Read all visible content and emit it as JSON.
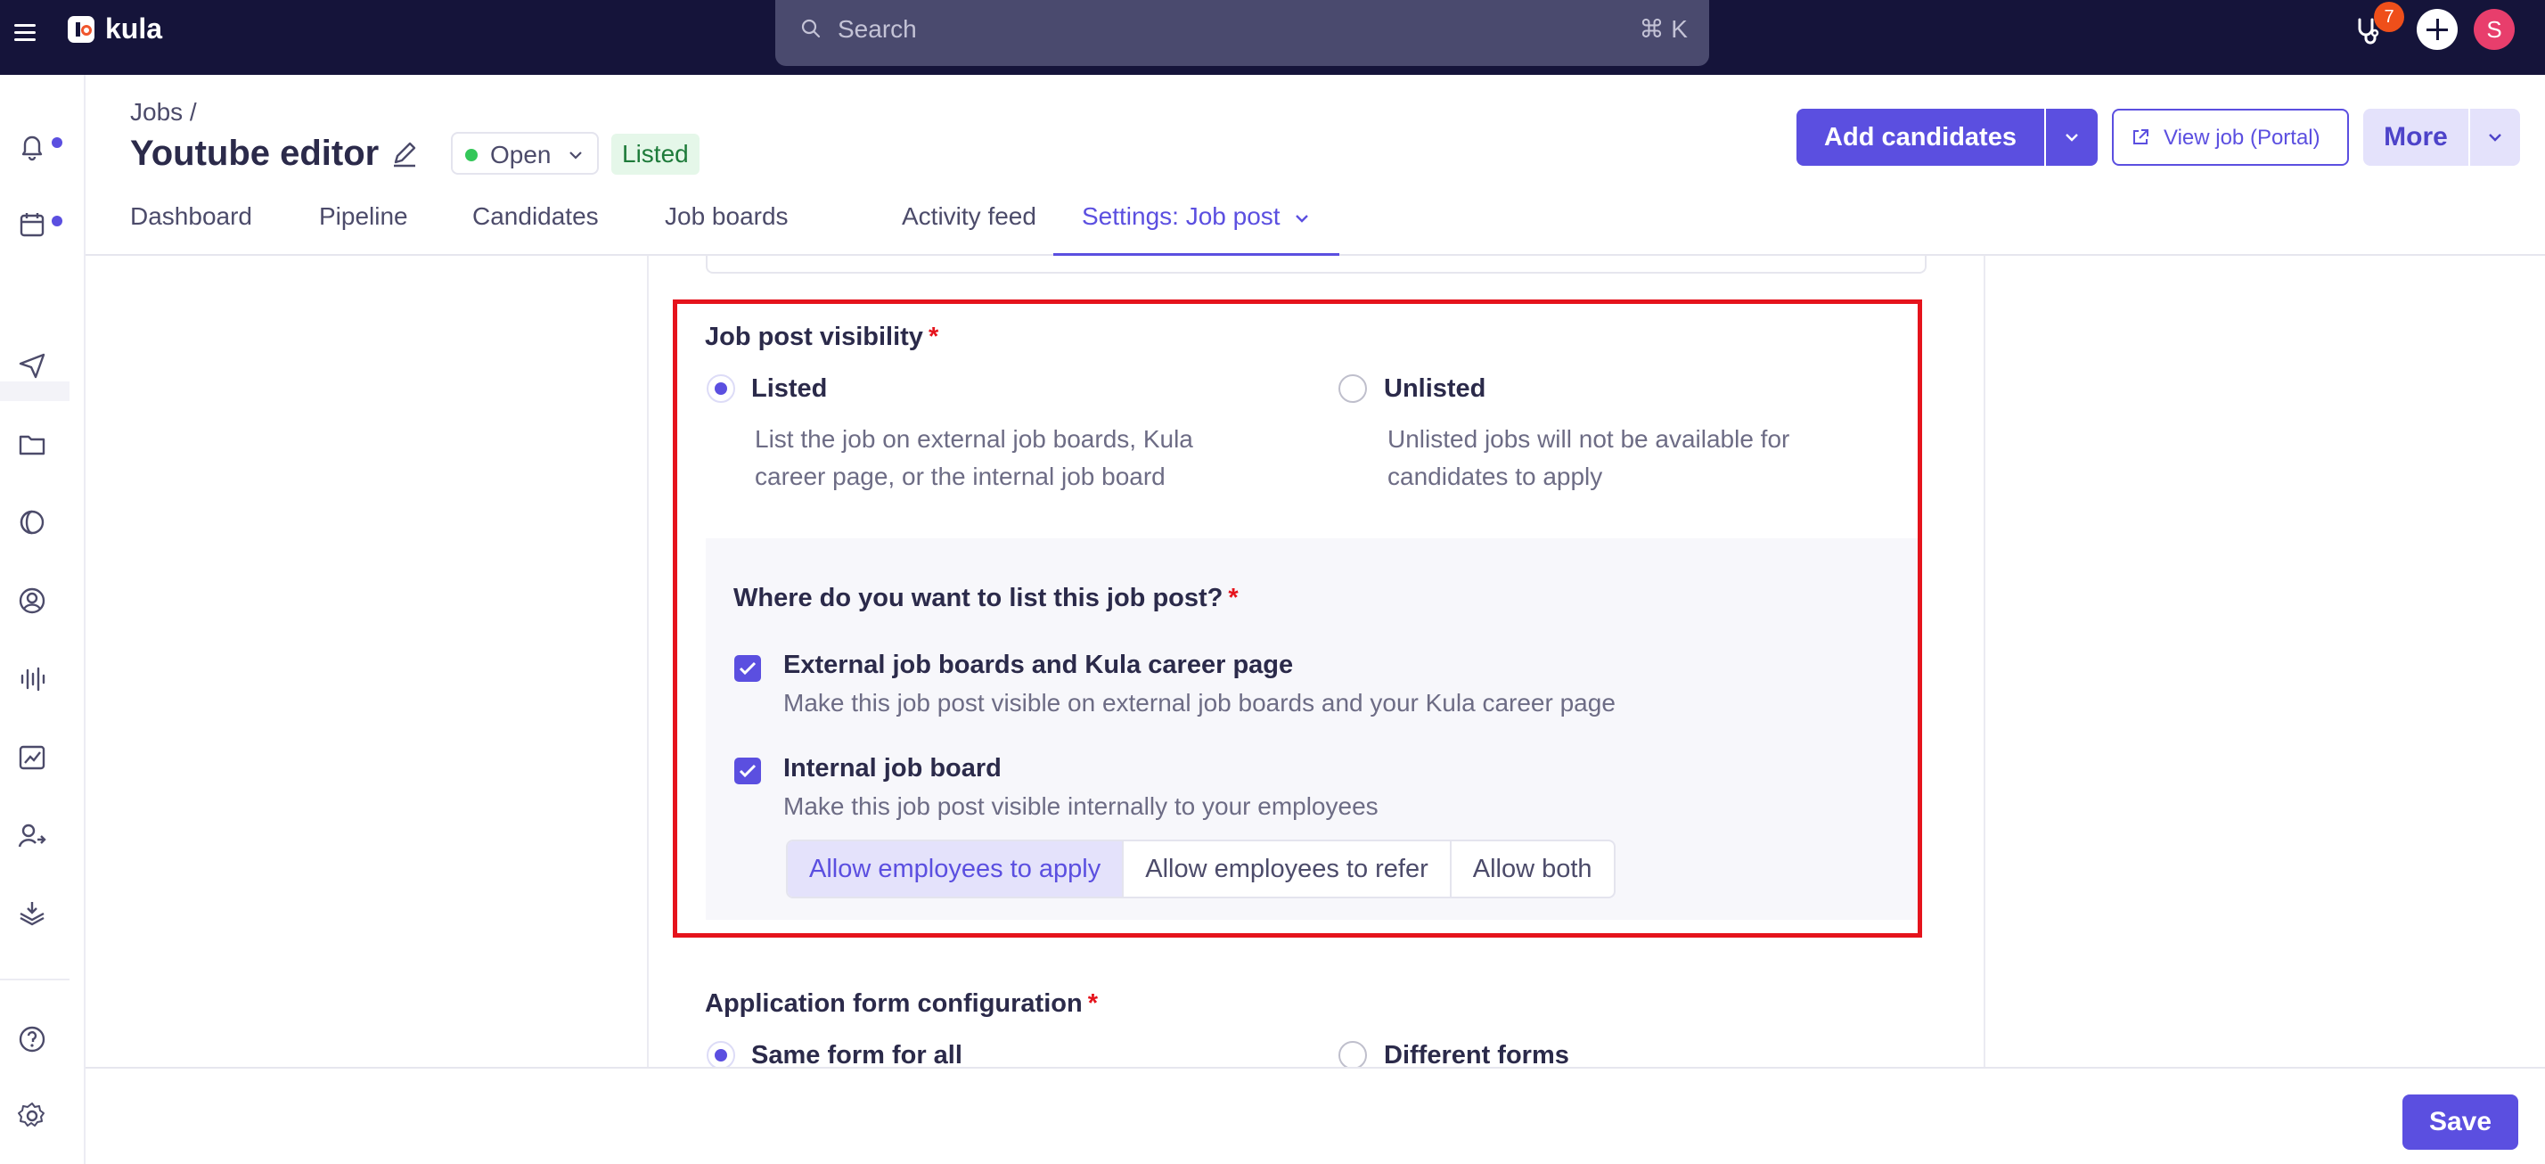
{
  "app": {
    "name": "kula"
  },
  "search": {
    "placeholder": "Search",
    "shortcut": "⌘ K"
  },
  "topbar": {
    "notification_count": "7",
    "avatar_initial": "S"
  },
  "header": {
    "breadcrumb": "Jobs /",
    "title": "Youtube editor",
    "status": "Open",
    "listing_badge": "Listed",
    "add_candidates_label": "Add candidates",
    "view_job_label": "View job (Portal)",
    "more_label": "More"
  },
  "tabs": [
    "Dashboard",
    "Pipeline",
    "Candidates",
    "Job boards",
    "Activity feed",
    "Settings: Job post"
  ],
  "active_tab": "Settings: Job post",
  "visibility": {
    "label": "Job post visibility",
    "required_mark": "*",
    "options": [
      {
        "label": "Listed",
        "desc_line1": "List the job on external job boards, Kula",
        "desc_line2": "career page, or the internal job board",
        "selected": true
      },
      {
        "label": "Unlisted",
        "desc_line1": "Unlisted jobs will not be available for",
        "desc_line2": "candidates to apply",
        "selected": false
      }
    ]
  },
  "listing_targets": {
    "label": "Where do you want to list this job post?",
    "required_mark": "*",
    "items": [
      {
        "title": "External job boards and Kula career page",
        "desc": "Make this job post visible on external job boards and your Kula career page",
        "checked": true
      },
      {
        "title": "Internal job board",
        "desc": "Make this job post visible internally to your employees",
        "checked": true
      }
    ],
    "employee_options": [
      "Allow employees to apply",
      "Allow employees to refer",
      "Allow both"
    ],
    "employee_selected": "Allow employees to apply"
  },
  "application_form": {
    "label": "Application form configuration",
    "required_mark": "*",
    "options": [
      {
        "label": "Same form for all",
        "selected": true
      },
      {
        "label": "Different forms",
        "selected": false
      }
    ]
  },
  "footer": {
    "save_label": "Save"
  },
  "colors": {
    "brand": "#5b4fe0",
    "topbar": "#15143a",
    "highlight": "#e5131c",
    "open_dot": "#34c759"
  }
}
